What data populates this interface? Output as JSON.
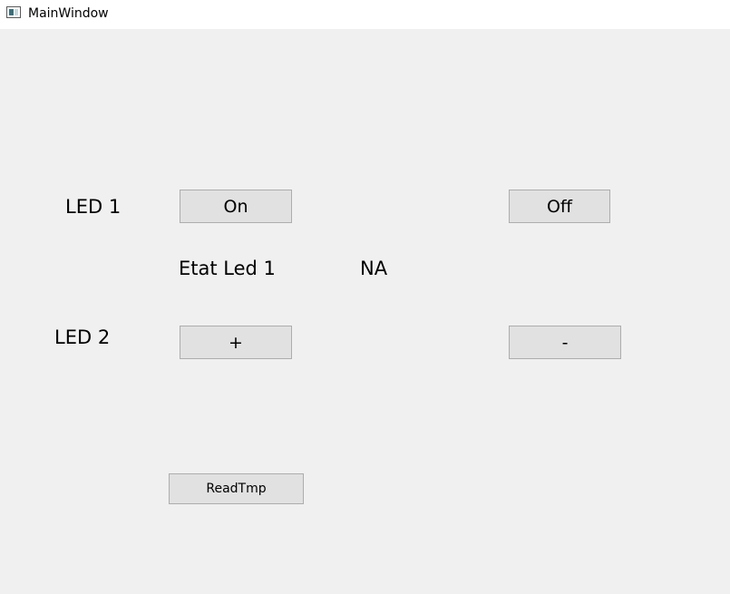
{
  "window": {
    "title": "MainWindow",
    "icon": "window-app-icon"
  },
  "labels": {
    "led1": "LED 1",
    "led2": "LED 2",
    "etat_led1": "Etat Led 1",
    "etat_value": "NA"
  },
  "buttons": {
    "led1_on": "On",
    "led1_off": "Off",
    "led2_plus": "+",
    "led2_minus": "-",
    "read_tmp": "ReadTmp"
  },
  "colors": {
    "background": "#f0f0f0",
    "titlebar": "#ffffff",
    "button_face": "#e1e1e1",
    "button_border": "#adadad"
  }
}
